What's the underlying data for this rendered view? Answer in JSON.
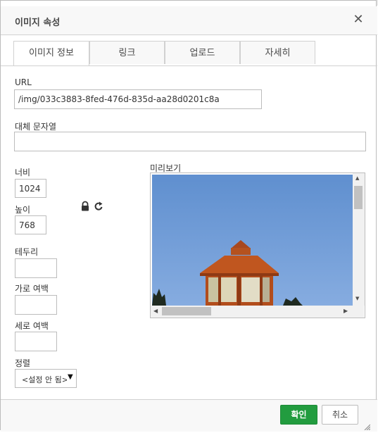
{
  "dialog": {
    "title": "이미지 속성",
    "close_glyph": "✕"
  },
  "tabs": [
    {
      "label": "이미지 정보",
      "active": true
    },
    {
      "label": "링크",
      "active": false
    },
    {
      "label": "업로드",
      "active": false
    },
    {
      "label": "자세히",
      "active": false
    }
  ],
  "fields": {
    "url": {
      "label": "URL",
      "value": "/img/033c3883-8fed-476d-835d-aa28d0201c8a"
    },
    "alt": {
      "label": "대체 문자열",
      "value": ""
    },
    "width": {
      "label": "너비",
      "value": "1024"
    },
    "height": {
      "label": "높이",
      "value": "768"
    },
    "border": {
      "label": "테두리",
      "value": ""
    },
    "hspace": {
      "label": "가로 여백",
      "value": ""
    },
    "vspace": {
      "label": "세로 여백",
      "value": ""
    },
    "align": {
      "label": "정렬",
      "value": "<설정 안 됨>"
    }
  },
  "preview": {
    "label": "미리보기"
  },
  "footer": {
    "ok_label": "확인",
    "cancel_label": "취소"
  },
  "colors": {
    "accent": "#229c3f",
    "sky": "#6f9fda"
  }
}
